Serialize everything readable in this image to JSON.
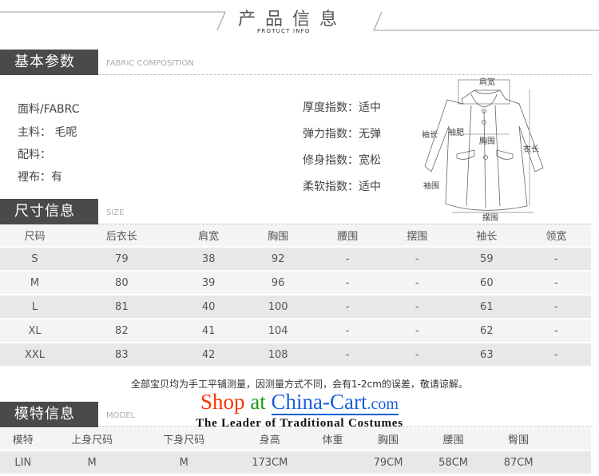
{
  "header": {
    "title_cn": "产品信息",
    "title_en": "PROTUCT INFO"
  },
  "sections": {
    "fabric": {
      "title": "基本参数",
      "subtitle": "FABRIC COMPOSITION"
    },
    "size": {
      "title": "尺寸信息",
      "subtitle": "SIZE"
    },
    "model": {
      "title": "模特信息",
      "subtitle": "MODEL"
    }
  },
  "fabric": {
    "left": [
      "面料/FABRC",
      "主料： 毛呢",
      "配料：",
      "裡布：有"
    ],
    "right": [
      "厚度指数：适中",
      "弹力指数：无弹",
      "修身指数：宽松",
      "柔软指数：适中"
    ]
  },
  "diagram": {
    "labels": [
      "肩宽",
      "袖长",
      "袖肥",
      "胸围",
      "衣长",
      "袖围",
      "摆围"
    ]
  },
  "size_table": {
    "headers": [
      "尺码",
      "后衣长",
      "肩宽",
      "胸围",
      "腰围",
      "摆围",
      "袖长",
      "领宽"
    ],
    "rows": [
      [
        "S",
        "79",
        "38",
        "92",
        "-",
        "-",
        "59",
        "-"
      ],
      [
        "M",
        "80",
        "39",
        "96",
        "-",
        "-",
        "60",
        "-"
      ],
      [
        "L",
        "81",
        "40",
        "100",
        "-",
        "-",
        "61",
        "-"
      ],
      [
        "XL",
        "82",
        "41",
        "104",
        "-",
        "-",
        "62",
        "-"
      ],
      [
        "XXL",
        "83",
        "42",
        "108",
        "-",
        "-",
        "63",
        "-"
      ]
    ]
  },
  "note": "全部宝贝均为手工平铺测量，因测量方式不同，会有1-2cm的误差，敬请谅解。",
  "watermark": {
    "shop": "Shop",
    "at": "at",
    "site": "China-Cart",
    "com": ".com",
    "tagline": "The Leader of  Traditional Costumes",
    "colors": {
      "shop": "#ff3300",
      "at": "#1a9a1a",
      "site": "#1a5fd8"
    }
  },
  "model_table": {
    "headers": [
      "模特",
      "上身尺码",
      "下身尺码",
      "身高",
      "体重",
      "胸围",
      "腰围",
      "臀围"
    ],
    "rows": [
      [
        "LIN",
        "M",
        "M",
        "173CM",
        "",
        "79CM",
        "58CM",
        "87CM"
      ]
    ]
  }
}
